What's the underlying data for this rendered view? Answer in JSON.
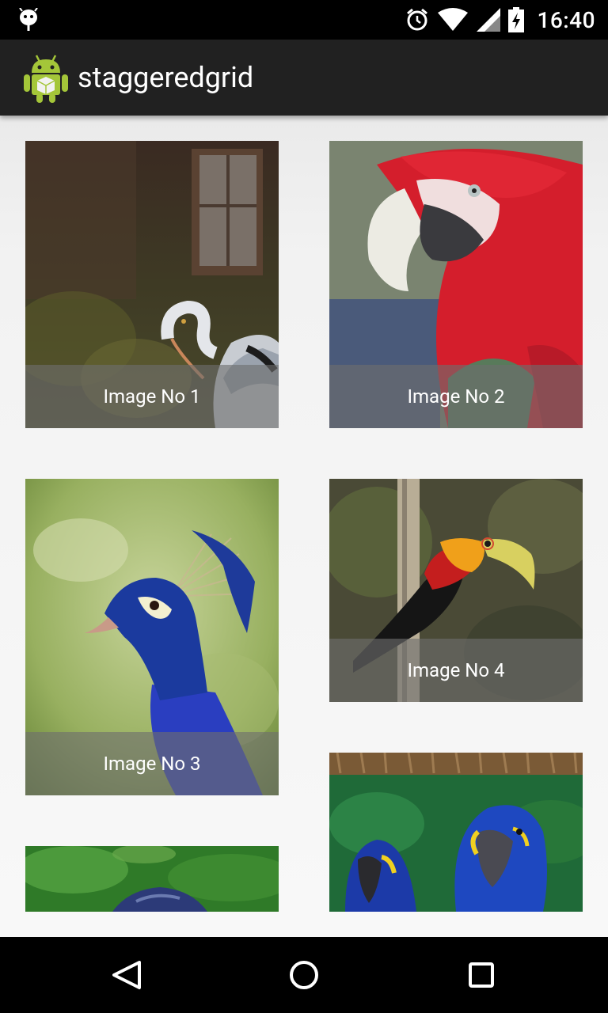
{
  "status_bar": {
    "time": "16:40",
    "icons": [
      "android-debug-icon",
      "alarm-icon",
      "wifi-icon",
      "signal-icon",
      "battery-charging-icon"
    ]
  },
  "app_bar": {
    "title": "staggeredgrid",
    "icon": "android-robot-icon"
  },
  "grid": {
    "items": [
      {
        "caption": "Image No 1",
        "subject": "heron"
      },
      {
        "caption": "Image No 2",
        "subject": "scarlet-macaw"
      },
      {
        "caption": "Image No 3",
        "subject": "peacock"
      },
      {
        "caption": "Image No 4",
        "subject": "toucan"
      },
      {
        "caption": "",
        "subject": "green-bird-partial"
      },
      {
        "caption": "",
        "subject": "hyacinth-macaws-partial"
      }
    ]
  },
  "nav_bar": {
    "buttons": [
      "back-icon",
      "home-icon",
      "recents-icon"
    ]
  },
  "colors": {
    "status_bar": "#000000",
    "app_bar": "#212121",
    "content_background": "#f2f2f2",
    "caption_overlay": "#6e6e6e"
  }
}
